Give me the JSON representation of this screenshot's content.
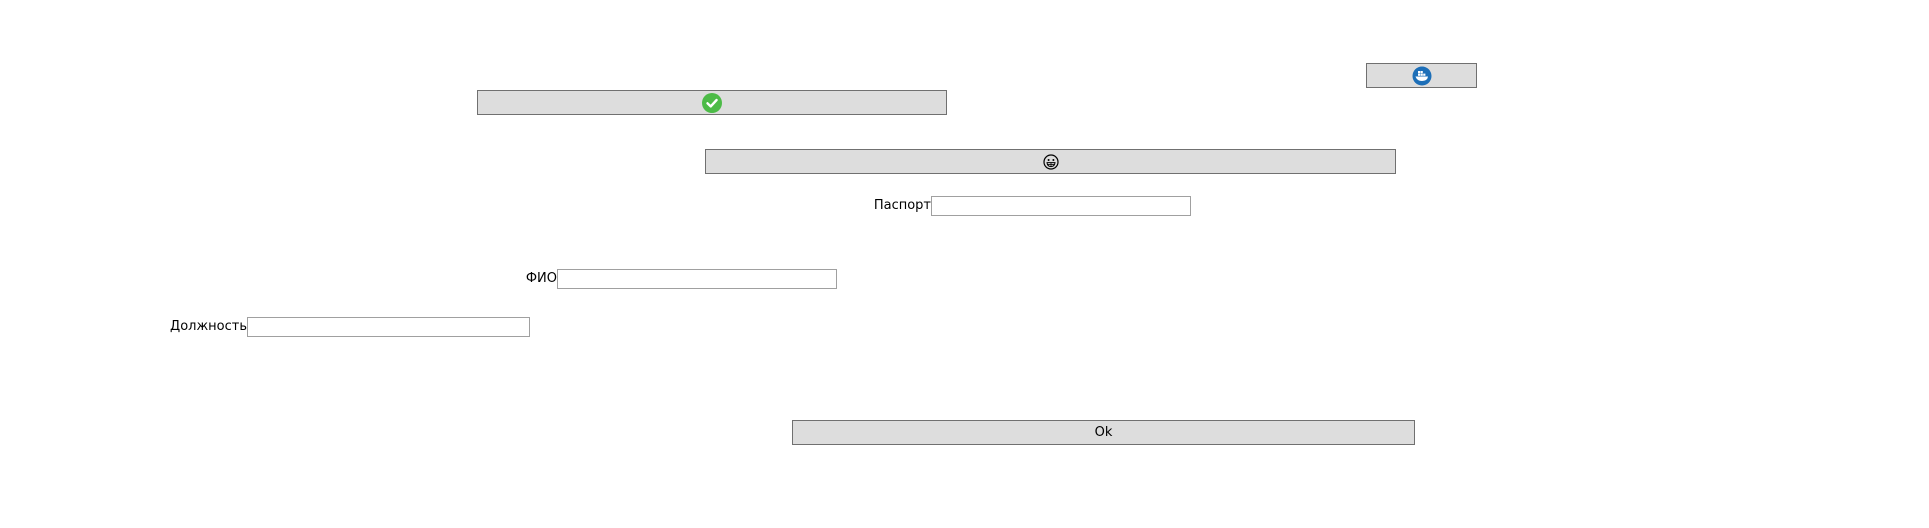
{
  "buttons": {
    "top_right_icon": "whale-logo-icon",
    "confirm_icon": "checkmark-icon",
    "face_icon": "grin-face-icon",
    "ok_label": "Ok"
  },
  "form": {
    "passport": {
      "label": "Паспорт",
      "value": ""
    },
    "fio": {
      "label": "ФИО",
      "value": ""
    },
    "position": {
      "label": "Должность",
      "value": ""
    }
  },
  "colors": {
    "button_bg": "#dddddd",
    "button_border": "#707070",
    "check_green": "#4cbb47",
    "logo_blue": "#1d6fb8"
  }
}
